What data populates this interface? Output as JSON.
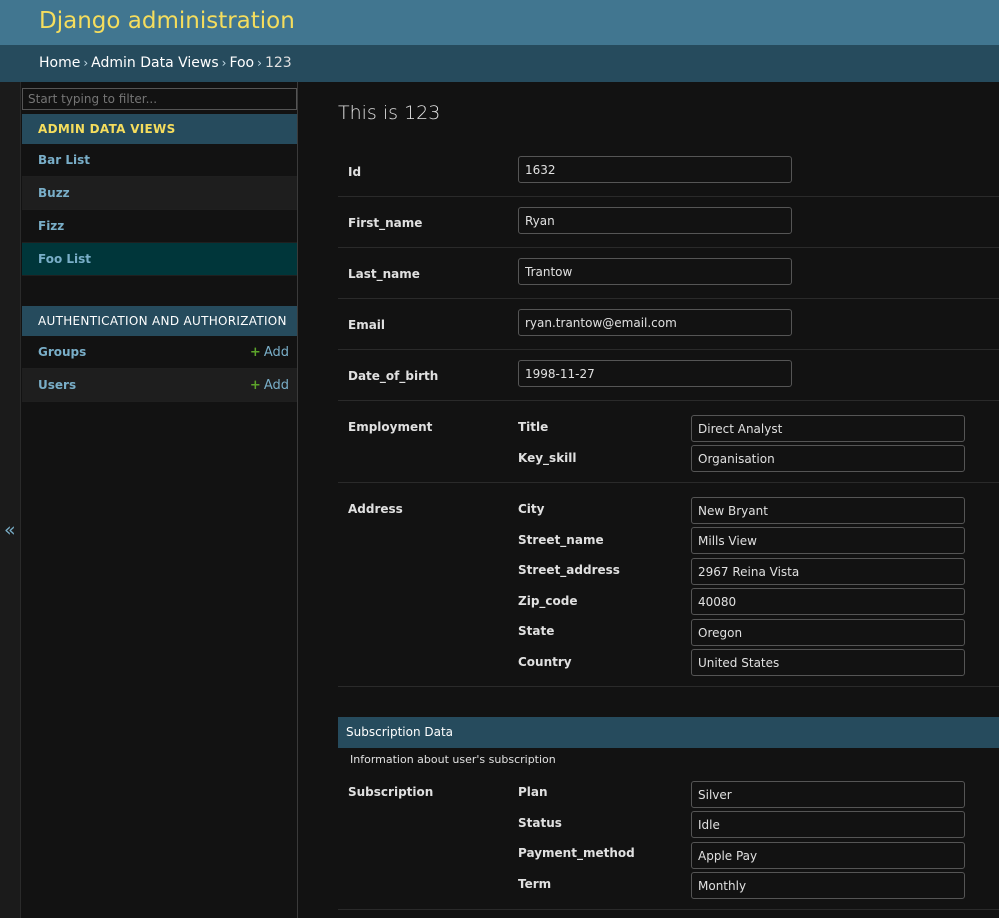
{
  "header": {
    "title": "Django administration"
  },
  "breadcrumbs": {
    "home": "Home",
    "app": "Admin Data Views",
    "model": "Foo",
    "object": "123",
    "separator": "›"
  },
  "sidebar": {
    "toggle_label": "«",
    "filter_placeholder": "Start typing to filter...",
    "modules": [
      {
        "caption": "ADMIN DATA VIEWS",
        "items": [
          {
            "label": "Bar List"
          },
          {
            "label": "Buzz"
          },
          {
            "label": "Fizz"
          },
          {
            "label": "Foo List"
          }
        ]
      },
      {
        "caption": "AUTHENTICATION AND AUTHORIZATION",
        "items": [
          {
            "label": "Groups",
            "add_label": "Add"
          },
          {
            "label": "Users",
            "add_label": "Add"
          }
        ]
      }
    ]
  },
  "main": {
    "title": "This is 123",
    "fields": {
      "id": {
        "label": "Id",
        "value": "1632"
      },
      "first_name": {
        "label": "First_name",
        "value": "Ryan"
      },
      "last_name": {
        "label": "Last_name",
        "value": "Trantow"
      },
      "email": {
        "label": "Email",
        "value": "ryan.trantow@email.com"
      },
      "date_of_birth": {
        "label": "Date_of_birth",
        "value": "1998-11-27"
      }
    },
    "employment": {
      "label": "Employment",
      "title": {
        "label": "Title",
        "value": "Direct Analyst"
      },
      "key_skill": {
        "label": "Key_skill",
        "value": "Organisation"
      }
    },
    "address": {
      "label": "Address",
      "city": {
        "label": "City",
        "value": "New Bryant"
      },
      "street_name": {
        "label": "Street_name",
        "value": "Mills View"
      },
      "street_address": {
        "label": "Street_address",
        "value": "2967 Reina Vista"
      },
      "zip_code": {
        "label": "Zip_code",
        "value": "40080"
      },
      "state": {
        "label": "State",
        "value": "Oregon"
      },
      "country": {
        "label": "Country",
        "value": "United States"
      }
    },
    "subscription_data": {
      "caption": "Subscription Data",
      "description": "Information about user's subscription",
      "label": "Subscription",
      "plan": {
        "label": "Plan",
        "value": "Silver"
      },
      "status": {
        "label": "Status",
        "value": "Idle"
      },
      "payment_method": {
        "label": "Payment_method",
        "value": "Apple Pay"
      },
      "term": {
        "label": "Term",
        "value": "Monthly"
      }
    }
  }
}
